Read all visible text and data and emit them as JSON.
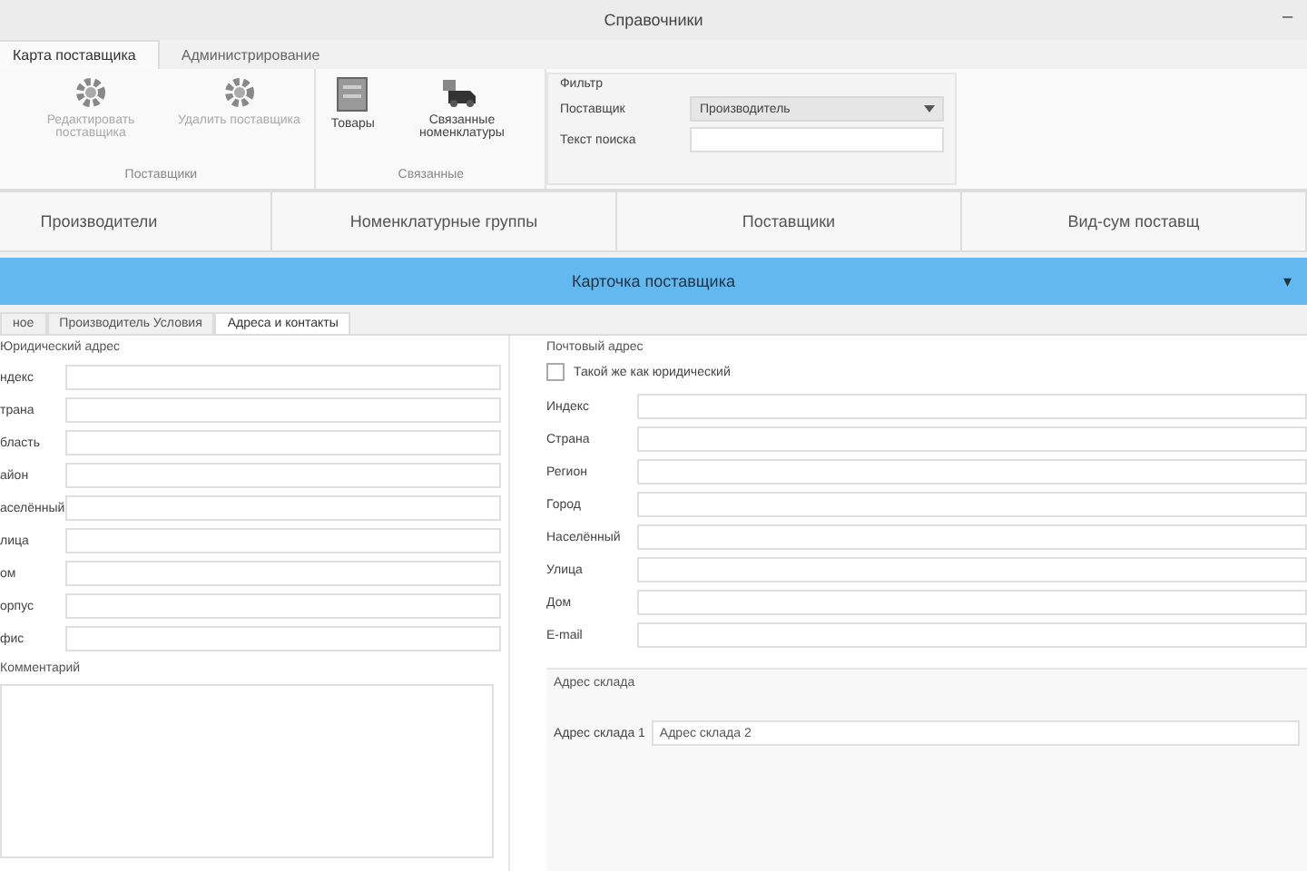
{
  "window": {
    "title": "Справочники",
    "control": "–"
  },
  "ribbon": {
    "tabs": [
      {
        "label": "Карта поставщика",
        "selected": true
      },
      {
        "label": "Администрирование",
        "selected": false
      }
    ],
    "groups": [
      {
        "label": "Поставщики",
        "buttons": [
          {
            "label": "Редактировать поставщика",
            "kind": "gear",
            "disabled": true
          },
          {
            "label": "Удалить поставщика",
            "kind": "gear",
            "disabled": true
          }
        ]
      },
      {
        "label": "Связанные",
        "buttons": [
          {
            "label": "Товары",
            "kind": "doc",
            "disabled": false
          },
          {
            "label": "Связанные номенклатуры",
            "kind": "truck",
            "disabled": false
          }
        ]
      }
    ],
    "filter": {
      "label": "Фильтр",
      "supplier_label": "Поставщик",
      "supplier_value": "Производитель",
      "search_label": "Текст поиска"
    }
  },
  "nav": [
    {
      "label": "Производители"
    },
    {
      "label": "Номенклатурные группы"
    },
    {
      "label": "Поставщики"
    },
    {
      "label": "Вид-сум поставщ"
    }
  ],
  "card": {
    "title": "Карточка поставщика",
    "toggle": "▾"
  },
  "subtabs": [
    {
      "label": "ное",
      "selected": false
    },
    {
      "label": "Производитель Условия",
      "selected": false
    },
    {
      "label": "Адреса и контакты",
      "selected": true
    }
  ],
  "legal": {
    "title": "Юридический адрес",
    "rows": [
      "ндекс",
      "трана",
      "бласть",
      "айон",
      "аселённый",
      "лица",
      "ом",
      "орпус",
      "фис"
    ]
  },
  "comment": {
    "title": "Комментарий"
  },
  "postal": {
    "title": "Почтовый адрес",
    "same_label": "Такой же как юридический",
    "same_checked": false,
    "rows": [
      "Индекс",
      "Страна",
      "Регион",
      "Город",
      "Населённый",
      "Улица",
      "Дом",
      "E-mail"
    ]
  },
  "warehouse": {
    "title": "Адрес склада",
    "label": "Адрес склада 1",
    "value": "Адрес склада 2"
  }
}
